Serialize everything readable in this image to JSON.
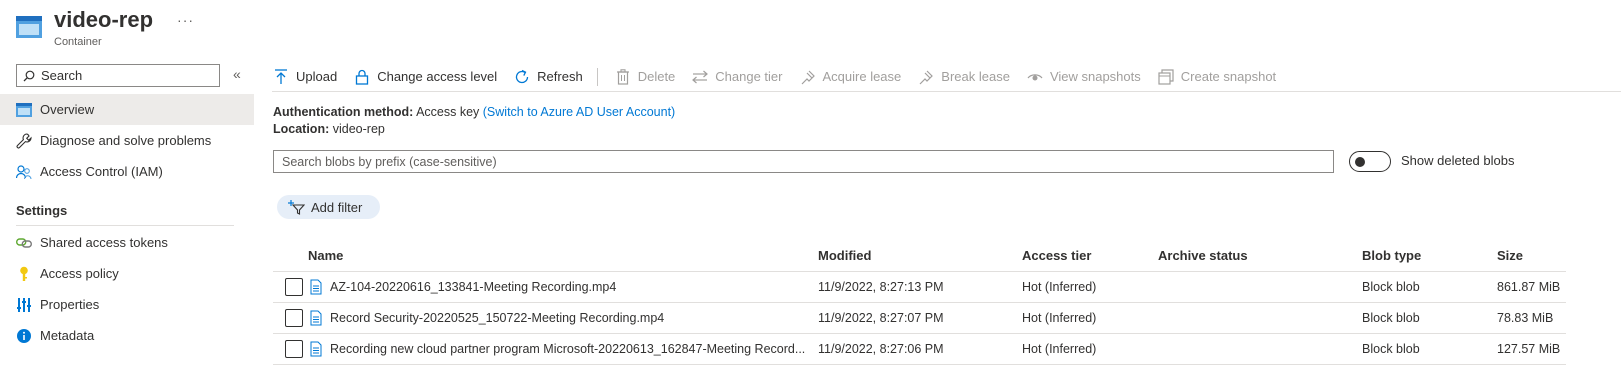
{
  "header": {
    "title": "video-rep",
    "more": "···",
    "subtitle": "Container"
  },
  "sidebar": {
    "search_placeholder": "Search",
    "collapse_glyph": "«",
    "items": [
      {
        "label": "Overview",
        "icon": "overview-icon"
      },
      {
        "label": "Diagnose and solve problems",
        "icon": "wrench-icon"
      },
      {
        "label": "Access Control (IAM)",
        "icon": "people-icon"
      }
    ],
    "settings_heading": "Settings",
    "settings_items": [
      {
        "label": "Shared access tokens",
        "icon": "link-icon"
      },
      {
        "label": "Access policy",
        "icon": "key-icon"
      },
      {
        "label": "Properties",
        "icon": "properties-icon"
      },
      {
        "label": "Metadata",
        "icon": "info-icon"
      }
    ]
  },
  "toolbar": {
    "upload": "Upload",
    "change_access": "Change access level",
    "refresh": "Refresh",
    "delete": "Delete",
    "change_tier": "Change tier",
    "acquire_lease": "Acquire lease",
    "break_lease": "Break lease",
    "view_snapshots": "View snapshots",
    "create_snapshot": "Create snapshot"
  },
  "info": {
    "auth_label": "Authentication method:",
    "auth_value": "Access key",
    "auth_link": "(Switch to Azure AD User Account)",
    "location_label": "Location:",
    "location_value": "video-rep"
  },
  "blob_search": {
    "placeholder": "Search blobs by prefix (case-sensitive)"
  },
  "show_deleted": {
    "label": "Show deleted blobs",
    "enabled": false
  },
  "filter": {
    "label": "Add filter"
  },
  "table": {
    "columns": [
      "Name",
      "Modified",
      "Access tier",
      "Archive status",
      "Blob type",
      "Size"
    ],
    "rows": [
      {
        "name": "AZ-104-20220616_133841-Meeting Recording.mp4",
        "modified": "11/9/2022, 8:27:13 PM",
        "tier": "Hot (Inferred)",
        "archive": "",
        "type": "Block blob",
        "size": "861.87 MiB"
      },
      {
        "name": "Record Security-20220525_150722-Meeting Recording.mp4",
        "modified": "11/9/2022, 8:27:07 PM",
        "tier": "Hot (Inferred)",
        "archive": "",
        "type": "Block blob",
        "size": "78.83 MiB"
      },
      {
        "name": "Recording new cloud partner program Microsoft-20220613_162847-Meeting Record...",
        "modified": "11/9/2022, 8:27:06 PM",
        "tier": "Hot (Inferred)",
        "archive": "",
        "type": "Block blob",
        "size": "127.57 MiB"
      }
    ]
  },
  "colors": {
    "accent": "#0078d4",
    "disabled": "#a19f9d",
    "selected_bg": "#edebe9",
    "filter_bg": "#e6eef8"
  }
}
